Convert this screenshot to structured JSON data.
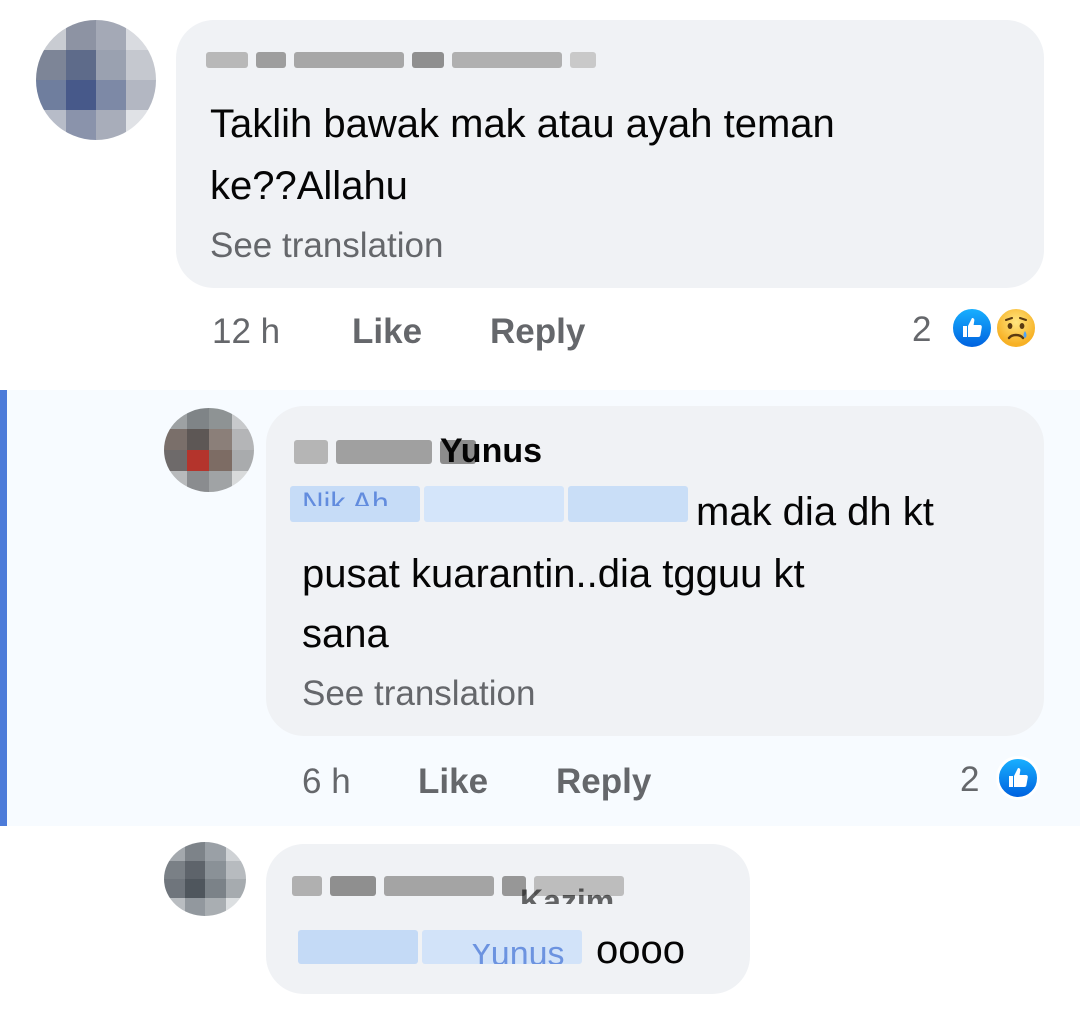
{
  "comments": [
    {
      "text_line1": "Taklih bawak mak atau ayah teman",
      "text_line2": "ke??Allahu",
      "see_translation": "See translation",
      "time": "12 h",
      "like": "Like",
      "reply": "Reply",
      "reaction_count": "2",
      "reactions": [
        "like-icon",
        "sad-icon"
      ]
    },
    {
      "name_fragment": "Yunus",
      "mention_fragment": "Nik Ah",
      "text_line1": "mak dia dh kt",
      "text_line2": "pusat kuarantin..dia tgguu kt",
      "text_line3": "sana",
      "see_translation": "See translation",
      "time": "6 h",
      "like": "Like",
      "reply": "Reply",
      "reaction_count": "2",
      "reactions": [
        "like-icon"
      ]
    },
    {
      "name_fragment": "Kazim",
      "mention_fragment": "Yunus",
      "text": "oooo"
    }
  ],
  "colors": {
    "bubble": "#f0f2f5",
    "meta": "#65676b",
    "highlight_bar": "#4c7bd9",
    "like_blue": "#1877f2",
    "mention_blue": "#385898"
  }
}
